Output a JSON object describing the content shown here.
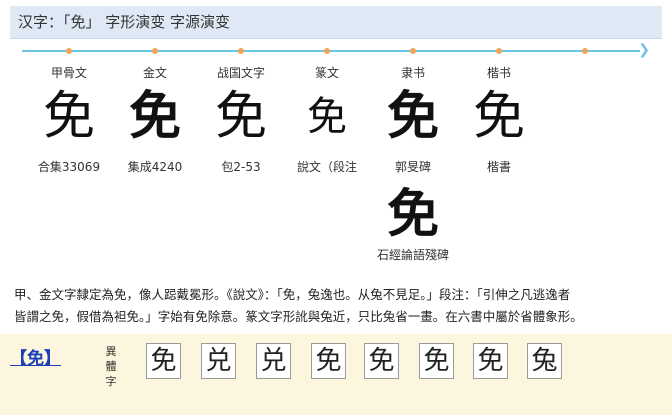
{
  "header": {
    "title": "汉字：「免」 字形演变 字源演变"
  },
  "timeline": {
    "stages": [
      {
        "era": "甲骨文",
        "glyph": "免",
        "source": "合集33069",
        "style": "thin"
      },
      {
        "era": "金文",
        "glyph": "免",
        "source": "集成4240",
        "style": "bold"
      },
      {
        "era": "战国文字",
        "glyph": "免",
        "source": "包2-53",
        "style": "thin"
      },
      {
        "era": "篆文",
        "glyph": "免",
        "source": "說文（段注",
        "style": "thin"
      },
      {
        "era": "隶书",
        "glyph": "免",
        "source": "郭旻碑",
        "style": "bold"
      },
      {
        "era": "楷书",
        "glyph": "免",
        "source": "楷書",
        "style": "thin"
      }
    ],
    "extra": {
      "glyph": "免",
      "source": "石經論語殘碑"
    }
  },
  "description": {
    "line1": "甲、金文字隸定為免，像人跽戴冕形。《說文》：「免，兔逸也。从兔不見足。」段注：「引伸之凡逃逸者",
    "line2": "皆謂之免，假借為袒免。」字始有免除意。篆文字形訛與兔近，只比兔省一畫。在六書中屬於省體象形。"
  },
  "variants": {
    "link_label": "【免】",
    "label": "異體字",
    "chars": [
      "免",
      "兑",
      "兑",
      "免",
      "免",
      "免",
      "免",
      "兔"
    ]
  }
}
